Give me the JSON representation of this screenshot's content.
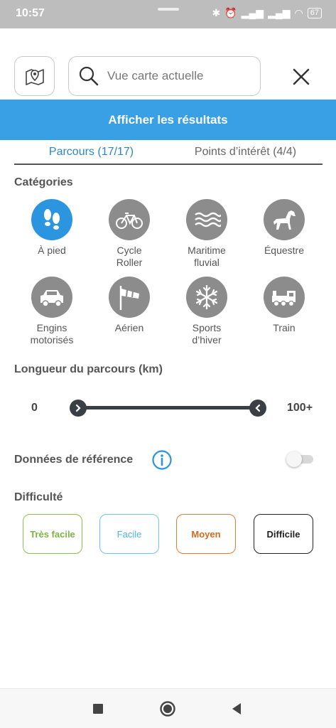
{
  "status_bar": {
    "time": "10:57",
    "battery": "67"
  },
  "search": {
    "placeholder": "Vue carte actuelle"
  },
  "results_button": {
    "label": "Afficher les résultats"
  },
  "tabs": [
    {
      "label": "Parcours (17/17)",
      "active": true
    },
    {
      "label": "Points d’intérêt (4/4)",
      "active": false
    }
  ],
  "categories": {
    "title": "Catégories",
    "items": [
      {
        "line1": "À pied",
        "line2": "",
        "icon": "footprints-icon",
        "active": true
      },
      {
        "line1": "Cycle",
        "line2": "Roller",
        "icon": "bicycle-icon",
        "active": false
      },
      {
        "line1": "Maritime",
        "line2": "fluvial",
        "icon": "waves-icon",
        "active": false
      },
      {
        "line1": "Équestre",
        "line2": "",
        "icon": "horse-icon",
        "active": false
      },
      {
        "line1": "Engins",
        "line2": "motorisés",
        "icon": "car-icon",
        "active": false
      },
      {
        "line1": "Aérien",
        "line2": "",
        "icon": "windsock-icon",
        "active": false
      },
      {
        "line1": "Sports",
        "line2": "d’hiver",
        "icon": "snowflake-icon",
        "active": false
      },
      {
        "line1": "Train",
        "line2": "",
        "icon": "train-icon",
        "active": false
      }
    ]
  },
  "length": {
    "title": "Longueur du parcours (km)",
    "min_label": "0",
    "max_label": "100+",
    "range": [
      0,
      100
    ]
  },
  "reference": {
    "label": "Données de référence",
    "enabled": false
  },
  "difficulty": {
    "title": "Difficulté",
    "options": [
      "Très facile",
      "Facile",
      "Moyen",
      "Difficile"
    ]
  },
  "colors": {
    "accent": "#3aa0e5",
    "category_active": "#2b95e0",
    "category_inactive": "#8c8c8c",
    "very_easy": "#7cb342",
    "easy": "#4fb3e6",
    "medium": "#d2691e",
    "hard": "#222222"
  }
}
